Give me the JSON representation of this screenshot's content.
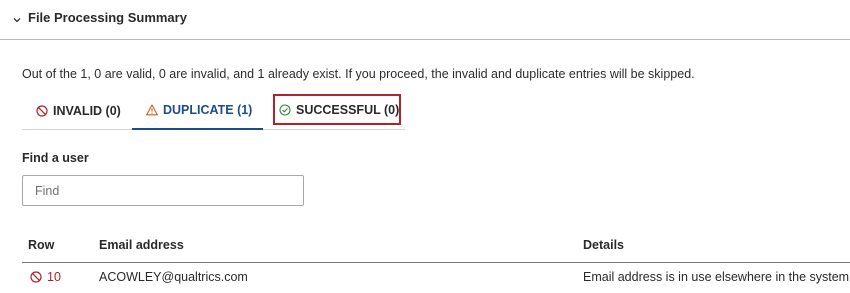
{
  "section": {
    "title": "File Processing Summary",
    "toggle_icon": "chevron-down-icon"
  },
  "summary": "Out of the 1, 0 are valid, 0 are invalid, and 1 already exist. If you proceed, the invalid and duplicate entries will be skipped.",
  "tabs": [
    {
      "label": "INVALID (0)",
      "icon": "prohibited-icon",
      "icon_color": "#b0232a",
      "active": false
    },
    {
      "label": "DUPLICATE (1)",
      "icon": "warning-triangle-icon",
      "icon_color": "#c8611a",
      "active": true
    },
    {
      "label": "SUCCESSFUL (0)",
      "icon": "check-circle-icon",
      "icon_color": "#2f8a3a",
      "active": false,
      "highlighted": true
    }
  ],
  "find": {
    "label": "Find a user",
    "placeholder": "Find"
  },
  "table": {
    "columns": [
      "Row",
      "Email address",
      "Details"
    ],
    "rows": [
      {
        "row": "10",
        "status_icon": "prohibited-icon",
        "email": "ACOWLEY@qualtrics.com",
        "details": "Email address is in use elsewhere in the system."
      }
    ]
  },
  "colors": {
    "accent": "#1c4c8b",
    "highlight_border": "#b0232a",
    "error": "#b0232a"
  }
}
